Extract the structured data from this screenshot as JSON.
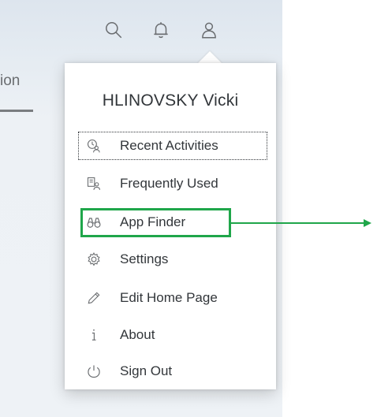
{
  "header": {
    "tab_fragment": "ion",
    "icons": [
      "search-icon",
      "bell-icon",
      "user-icon"
    ]
  },
  "user_menu": {
    "user_name": "HLINOVSKY Vicki",
    "items": [
      {
        "label": "Recent Activities",
        "icon": "recent-activities-icon"
      },
      {
        "label": "Frequently Used",
        "icon": "frequently-used-icon"
      },
      {
        "label": "App Finder",
        "icon": "binoculars-icon"
      },
      {
        "label": "Settings",
        "icon": "gear-icon"
      },
      {
        "label": "Edit Home Page",
        "icon": "pencil-icon"
      },
      {
        "label": "About",
        "icon": "info-icon"
      },
      {
        "label": "Sign Out",
        "icon": "power-icon"
      }
    ]
  },
  "annotation": {
    "highlighted_item": "App Finder",
    "color": "#1fa64a"
  },
  "colors": {
    "text": "#32363a",
    "icon": "#6a6d70",
    "background": "#eef2f6"
  }
}
